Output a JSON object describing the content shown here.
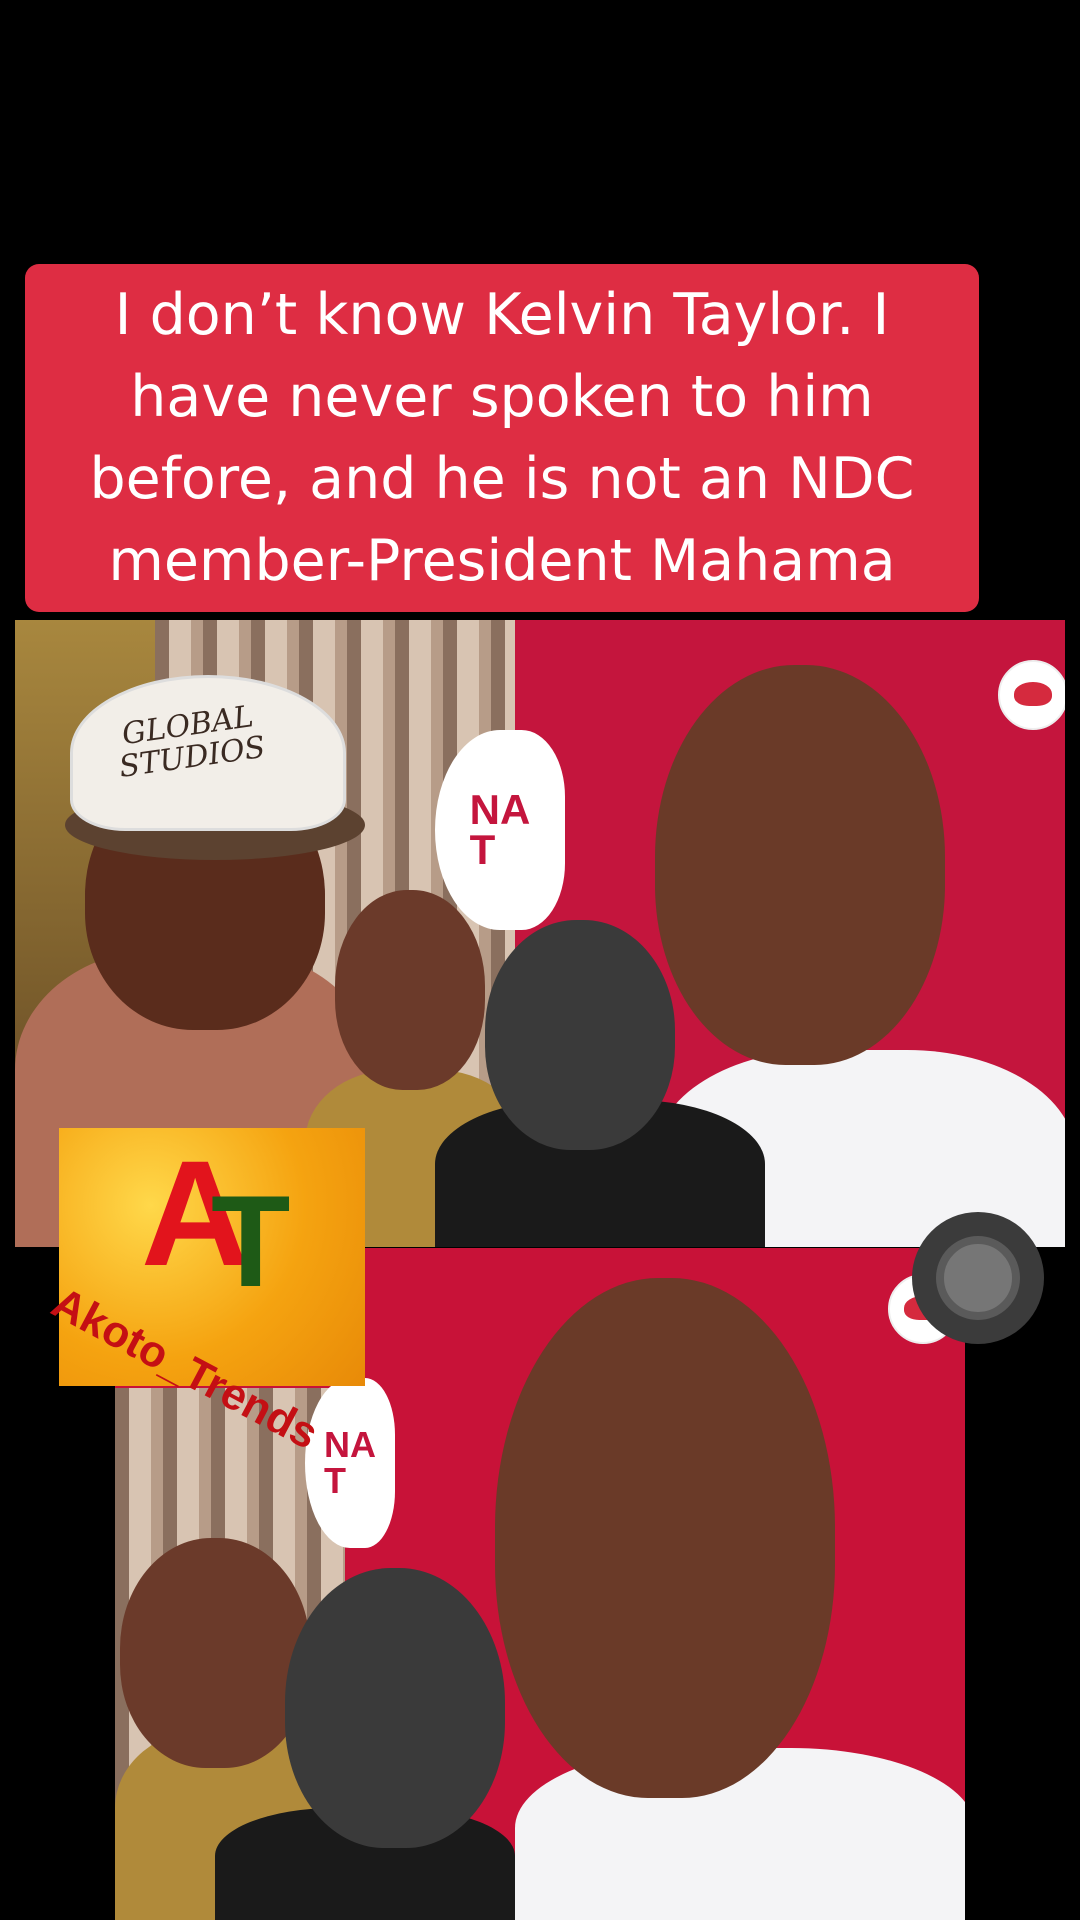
{
  "headline": {
    "text": "I don’t know Kelvin Taylor. I have never spoken to him before, and he is not an NDC member-President Mahama"
  },
  "panels": {
    "top": {
      "logo_text": "NA\nT",
      "cap_text": "GLOBAL STUDIOS"
    },
    "bottom": {
      "logo_text": "NA\nT"
    }
  },
  "watermark": {
    "letter_a": "A",
    "letter_t": "T",
    "name": "Akoto_Trends"
  },
  "colors": {
    "banner": "#de2d43",
    "panel_red": "#c4153d",
    "background": "#000000"
  },
  "icons": [
    "record-button-icon",
    "channel-badge-icon"
  ]
}
